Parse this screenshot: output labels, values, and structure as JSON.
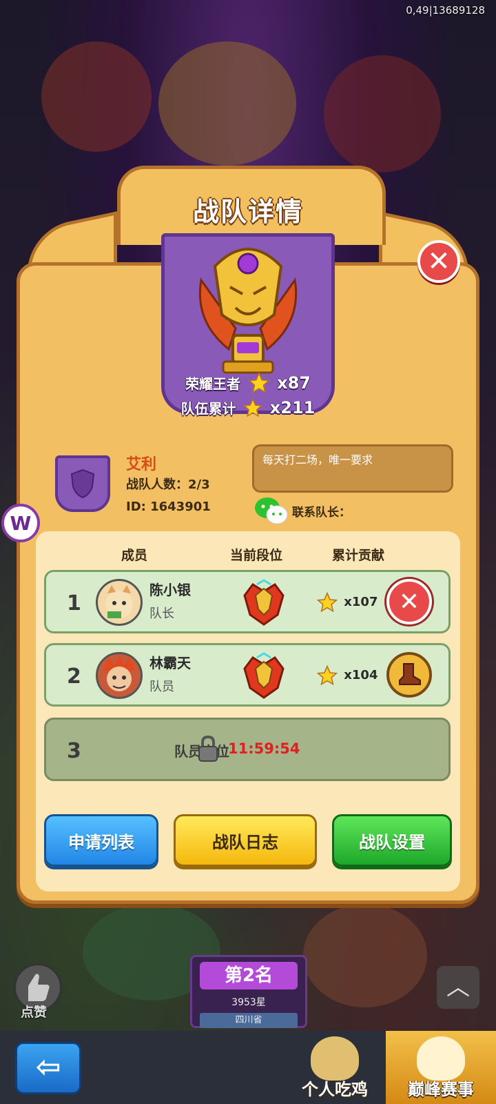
{
  "status": {
    "top_right": "0,49|13689128"
  },
  "dialog": {
    "title": "战队详情",
    "honor_label": "荣耀王者",
    "honor_value": "x87",
    "total_label": "队伍累计",
    "total_value": "x211"
  },
  "team": {
    "name": "艾利",
    "member_count": "战队人数：2/3",
    "id": "ID: 1643901",
    "motto": "每天打二场，唯一要求",
    "contact_label": "联系队长："
  },
  "columns": {
    "member": "成员",
    "rank": "当前段位",
    "contribution": "累计贡献"
  },
  "members": [
    {
      "index": "1",
      "name": "陈小银",
      "role": "队长",
      "contribution": "x107",
      "action_icon": "close-icon"
    },
    {
      "index": "2",
      "name": "林霸天",
      "role": "队员",
      "contribution": "x104",
      "action_icon": "boot-icon"
    }
  ],
  "locked_slot": {
    "index": "3",
    "label": "队员空位",
    "timer": "11:59:54"
  },
  "buttons": {
    "apply_list": "申请列表",
    "team_log": "战队日志",
    "team_settings": "战队设置"
  },
  "bottom": {
    "like_label": "点赞",
    "rank_place": "第2名",
    "rank_stars": "3953星",
    "rank_province": "四川省",
    "tab_personal": "个人吃鸡",
    "tab_peak": "巅峰赛事"
  },
  "colors": {
    "panel": "#f2bf62",
    "panel_border": "#b5722a",
    "banner": "#8a5ab8",
    "row_active": "#d8eccb",
    "row_locked": "#a6b48a",
    "timer": "#e02020",
    "team_name": "#d84a18"
  }
}
